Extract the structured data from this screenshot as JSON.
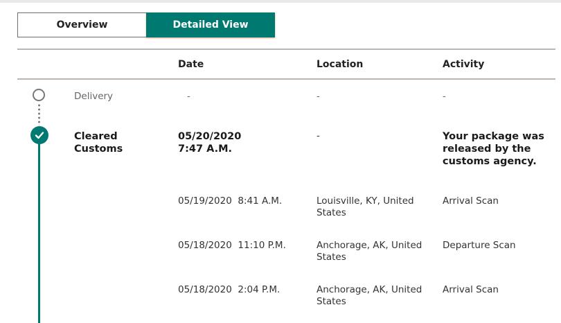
{
  "toggle": {
    "overview_label": "Overview",
    "detailed_label": "Detailed View",
    "active": "Detailed View"
  },
  "table": {
    "headers": {
      "date": "Date",
      "location": "Location",
      "activity": "Activity"
    },
    "status_rows": [
      {
        "status": "Delivery",
        "date": "-",
        "location": "-",
        "activity": "-",
        "state": "pending"
      },
      {
        "status_line1": "Cleared",
        "status_line2": "Customs",
        "date_line1": "05/20/2020",
        "date_line2": "7:47 A.M.",
        "location": "-",
        "activity_line1": "Your package was",
        "activity_line2": "released by the",
        "activity_line3": "customs agency.",
        "state": "complete"
      }
    ],
    "history": [
      {
        "date": "05/19/2020  8:41 A.M.",
        "location_line1": "Louisville, KY, United",
        "location_line2": "States",
        "activity": "Arrival Scan"
      },
      {
        "date": "05/18/2020  11:10 P.M.",
        "location_line1": "Anchorage, AK, United",
        "location_line2": "States",
        "activity": "Departure Scan"
      },
      {
        "date": "05/18/2020  2:04 P.M.",
        "location_line1": "Anchorage, AK, United",
        "location_line2": "States",
        "activity": "Arrival Scan"
      }
    ]
  },
  "colors": {
    "accent": "#007a71",
    "divider": "#bdb6b0",
    "pending": "#777777"
  },
  "icons": {
    "pending_status": "circle-outline-icon",
    "complete_status": "checkmark-circle-icon"
  }
}
